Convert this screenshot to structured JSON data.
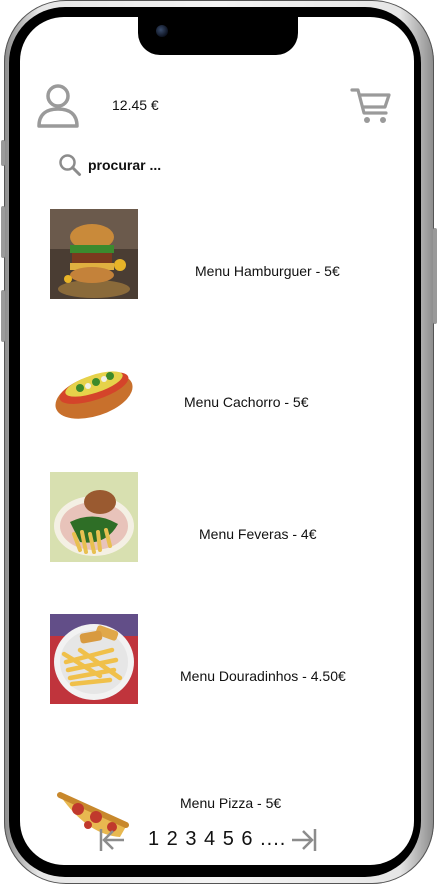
{
  "header": {
    "balance": "12.45 €"
  },
  "search": {
    "placeholder": "procurar ..."
  },
  "menu": [
    {
      "label": "Menu Hamburguer - 5€"
    },
    {
      "label": "Menu Cachorro - 5€"
    },
    {
      "label": "Menu Feveras - 4€"
    },
    {
      "label": "Menu Douradinhos - 4.50€"
    },
    {
      "label": "Menu Pizza - 5€"
    }
  ],
  "pagination": {
    "pages": "1 2 3 4 5 6 ...."
  },
  "icons": {
    "user": "user-icon",
    "cart": "cart-icon",
    "search": "search-icon",
    "prev": "arrow-left-to-bar-icon",
    "next": "arrow-right-to-bar-icon"
  }
}
